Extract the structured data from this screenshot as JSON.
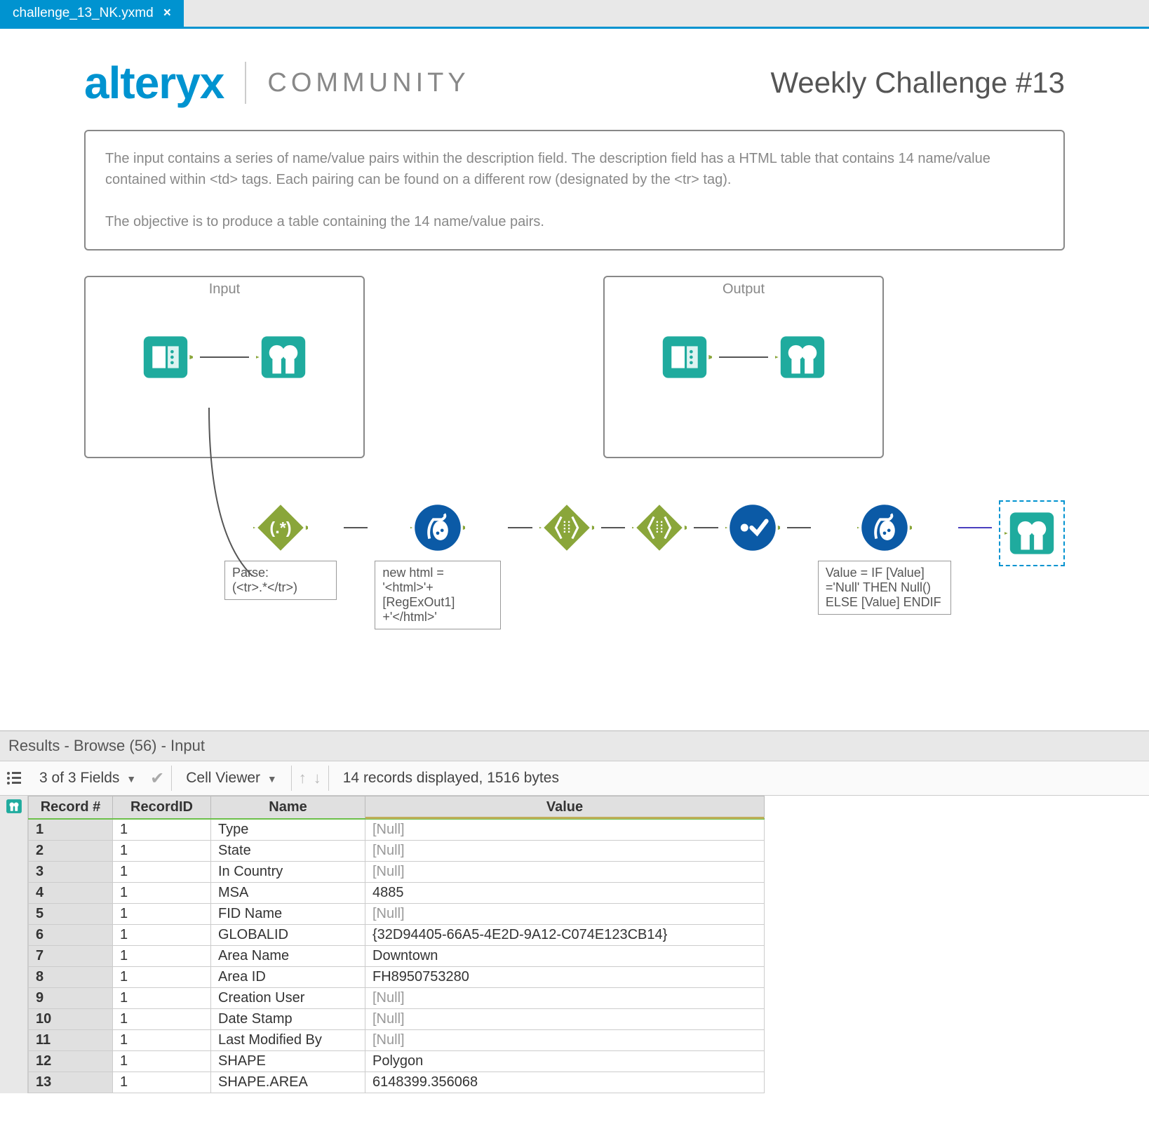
{
  "tab": {
    "name": "challenge_13_NK.yxmd",
    "close": "×"
  },
  "header": {
    "brand": "alteryx",
    "community": "COMMUNITY",
    "title": "Weekly Challenge #13"
  },
  "description": {
    "p1": "The input contains a series of name/value pairs within the description field. The description field has a HTML table that contains 14 name/value contained within <td> tags. Each pairing can be found on a different row (designated by the <tr> tag).",
    "p2": "The objective is to produce a table containing the 14 name/value pairs."
  },
  "containers": {
    "input": "Input",
    "output": "Output"
  },
  "annotations": {
    "regex": "Parse:\n(<tr>.*</tr>)",
    "formula1": "new html = '<html>'+ [RegExOut1] +'</html>'",
    "formula2": "Value = IF [Value] ='Null' THEN Null() ELSE [Value] ENDIF"
  },
  "results": {
    "title": "Results - Browse (56) - Input",
    "fields_summary": "3 of 3 Fields",
    "cell_viewer": "Cell Viewer",
    "status": "14 records displayed, 1516 bytes",
    "columns": [
      "Record #",
      "RecordID",
      "Name",
      "Value"
    ],
    "rows": [
      {
        "n": "1",
        "rid": "1",
        "name": "Type",
        "value": "[Null]",
        "null": true
      },
      {
        "n": "2",
        "rid": "1",
        "name": "State",
        "value": "[Null]",
        "null": true
      },
      {
        "n": "3",
        "rid": "1",
        "name": "In Country",
        "value": "[Null]",
        "null": true
      },
      {
        "n": "4",
        "rid": "1",
        "name": "MSA",
        "value": "4885",
        "null": false
      },
      {
        "n": "5",
        "rid": "1",
        "name": "FID Name",
        "value": "[Null]",
        "null": true
      },
      {
        "n": "6",
        "rid": "1",
        "name": "GLOBALID",
        "value": "{32D94405-66A5-4E2D-9A12-C074E123CB14}",
        "null": false
      },
      {
        "n": "7",
        "rid": "1",
        "name": "Area Name",
        "value": "Downtown",
        "null": false
      },
      {
        "n": "8",
        "rid": "1",
        "name": "Area ID",
        "value": "FH8950753280",
        "null": false
      },
      {
        "n": "9",
        "rid": "1",
        "name": "Creation User",
        "value": "[Null]",
        "null": true
      },
      {
        "n": "10",
        "rid": "1",
        "name": "Date Stamp",
        "value": "[Null]",
        "null": true
      },
      {
        "n": "11",
        "rid": "1",
        "name": "Last Modified By",
        "value": "[Null]",
        "null": true
      },
      {
        "n": "12",
        "rid": "1",
        "name": "SHAPE",
        "value": "Polygon",
        "null": false
      },
      {
        "n": "13",
        "rid": "1",
        "name": "SHAPE.AREA",
        "value": "6148399.356068",
        "null": false
      }
    ]
  },
  "colors": {
    "teal": "#1fab9e",
    "blue": "#0b5aa6",
    "olive": "#8aa63a"
  }
}
